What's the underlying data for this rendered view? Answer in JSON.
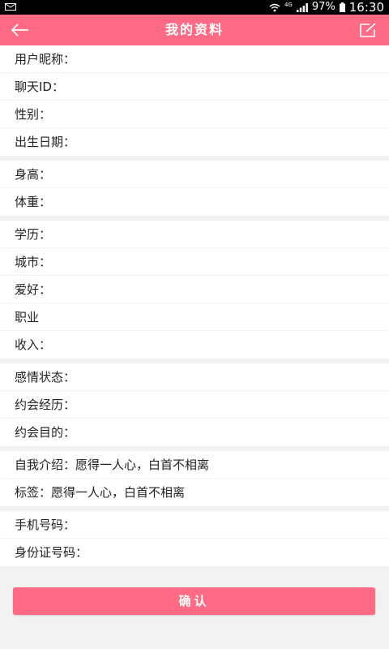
{
  "status_bar": {
    "network": "4G",
    "battery": "97%",
    "time": "16:30"
  },
  "app_bar": {
    "title": "我的资料"
  },
  "groups": [
    {
      "rows": [
        "用户昵称：",
        "聊天ID：",
        "性别：",
        "出生日期："
      ]
    },
    {
      "rows": [
        "身高：",
        "体重："
      ]
    },
    {
      "rows": [
        "学历：",
        "城市：",
        "爱好：",
        "职业",
        "收入："
      ]
    },
    {
      "rows": [
        "感情状态：",
        "约会经历：",
        "约会目的："
      ]
    },
    {
      "rows": [
        "自我介绍：愿得一人心，白首不相离",
        "标签：愿得一人心，白首不相离"
      ]
    },
    {
      "rows": [
        "手机号码：",
        "身份证号码："
      ]
    }
  ],
  "confirm_label": "确认",
  "colors": {
    "accent": "#ff6b85",
    "background": "#f2f2f2",
    "text": "#222222"
  }
}
